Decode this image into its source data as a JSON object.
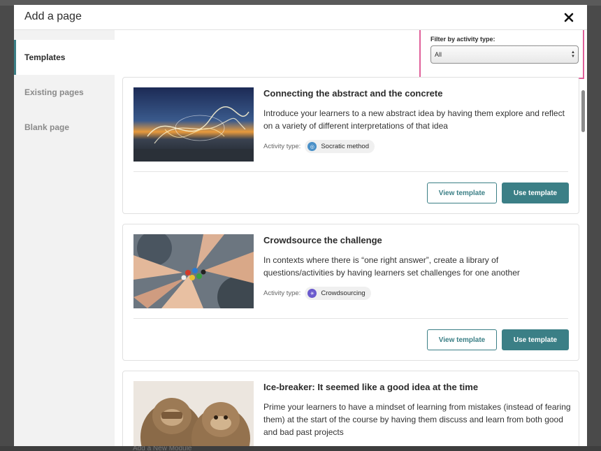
{
  "modal": {
    "title": "Add a page"
  },
  "sidebar": {
    "items": [
      {
        "label": "Templates",
        "active": true
      },
      {
        "label": "Existing pages",
        "active": false
      },
      {
        "label": "Blank page",
        "active": false
      }
    ]
  },
  "filter": {
    "label": "Filter by activity type:",
    "selected": "All"
  },
  "templates": [
    {
      "title": "Connecting the abstract and the concrete",
      "description": "Introduce your learners to a new abstract idea by having them explore and reflect on a variety of different interpretations of that idea",
      "activity_type_label": "Activity type:",
      "activity_type": "Socratic method",
      "activity_icon": "socratic-icon",
      "icon_color": "#4a90c8",
      "view_label": "View template",
      "use_label": "Use template"
    },
    {
      "title": "Crowdsource the challenge",
      "description": "In contexts where there is “one right answer”, create a library of questions/activities by having learners set challenges for one another",
      "activity_type_label": "Activity type:",
      "activity_type": "Crowdsourcing",
      "activity_icon": "crowdsourcing-icon",
      "icon_color": "#6a5acd",
      "view_label": "View template",
      "use_label": "Use template"
    },
    {
      "title": "Ice-breaker: It seemed like a good idea at the time",
      "description": "Prime your learners to have a mindset of learning from mistakes (instead of fearing them) at the start of the course by having them discuss and learn from both good and bad past projects"
    }
  ],
  "backdrop": {
    "bottom_label": "Add a New Module"
  },
  "colors": {
    "accent": "#3b7f86",
    "highlight": "#e0609a"
  }
}
